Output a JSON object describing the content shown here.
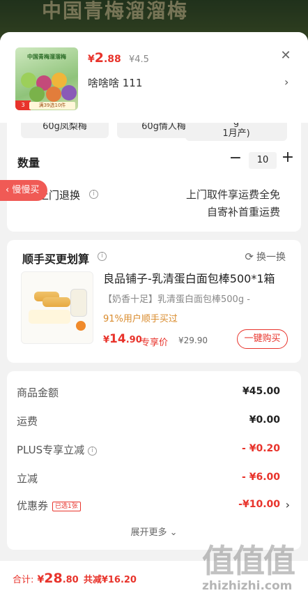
{
  "background": {
    "title": "中国青梅溜溜梅"
  },
  "product": {
    "image_title": "中国青梅溜溜梅",
    "image_badge": "3",
    "image_strip": "满39选10件",
    "price_currency": "¥",
    "price_int": "2",
    "price_dec": ".88",
    "original_price": "¥4.5",
    "selection": "啥啥啥  111"
  },
  "spec": {
    "options": [
      "60g凤梨梅",
      "60g情人梅",
      "g\n1月产)"
    ],
    "quantity_label": "数量",
    "quantity": "10",
    "return_label": "免费上门退换",
    "return_line1": "上门取件享运费全免",
    "return_line2": "自寄补首重运费"
  },
  "floating_tab": "慢慢买",
  "recommend": {
    "title": "顺手买更划算",
    "swap_label": "换一换",
    "name": "良品铺子-乳清蛋白面包棒500*1箱",
    "subtitle": "【奶香十足】乳清蛋白面包棒500g -",
    "percent_text": "91%用户顺手买过",
    "price_currency": "¥",
    "price_int": "14",
    "price_dec": ".90",
    "vip_label": "专享价",
    "original_price": "¥29.90",
    "buy_button": "一键购买"
  },
  "summary": {
    "rows": [
      {
        "label": "商品金额",
        "value": "¥45.00"
      },
      {
        "label": "运费",
        "value": "¥0.00"
      },
      {
        "label": "PLUS专享立减",
        "value": "- ¥0.20"
      },
      {
        "label": "立减",
        "value": "- ¥6.00"
      },
      {
        "label": "优惠券",
        "value": "-¥10.00",
        "tag": "已选1张"
      }
    ],
    "expand_label": "展开更多"
  },
  "footer": {
    "total_label": "合计:",
    "currency": "¥",
    "total_int": "28",
    "total_dec": ".80",
    "save_text": "共减¥16.20"
  },
  "watermark": {
    "glyph": "值值值",
    "url": "zhizhizhi.com"
  },
  "colors": {
    "accent": "#e8332b",
    "tab": "#f05a55",
    "background": "#f2f2f2"
  }
}
